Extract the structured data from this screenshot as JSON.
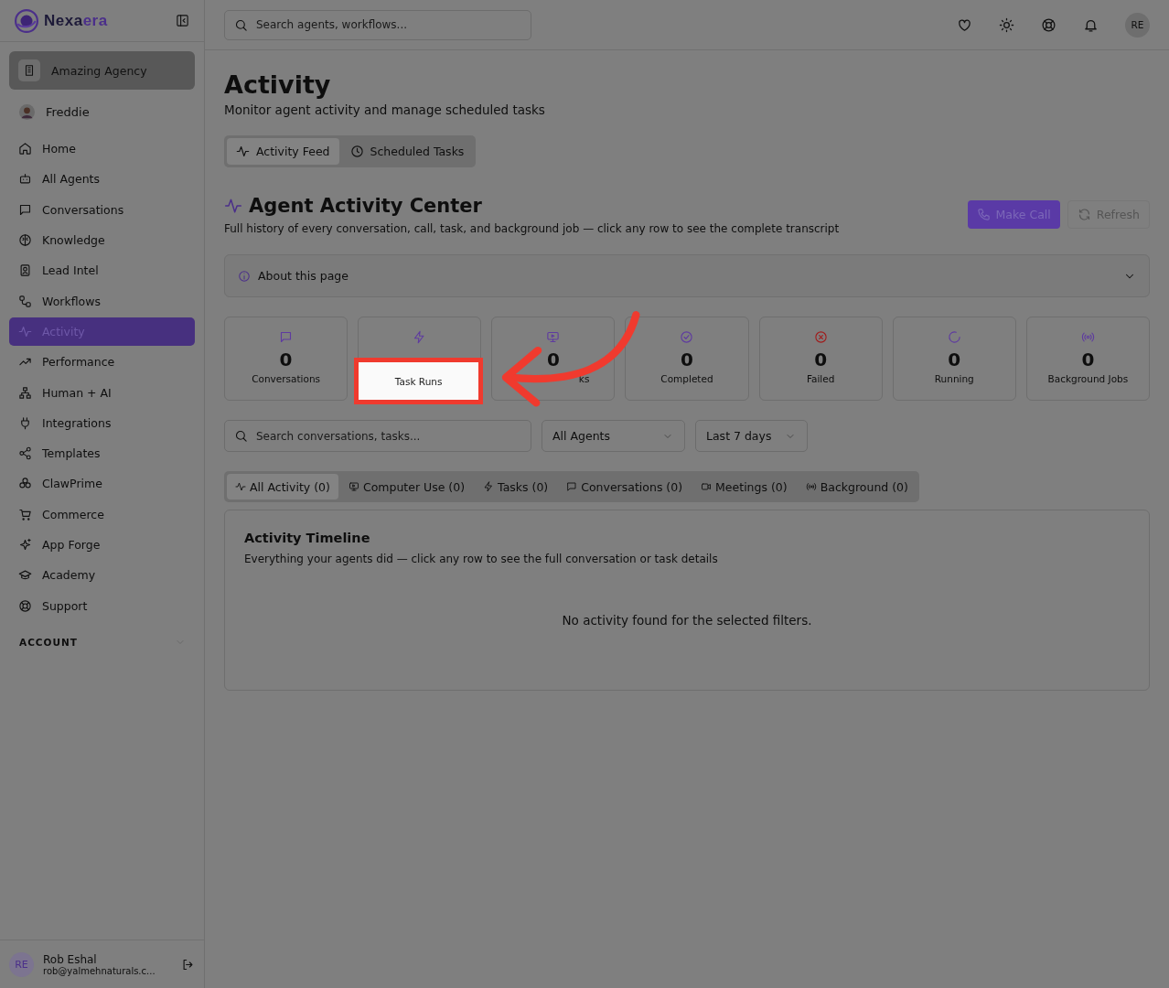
{
  "logo": {
    "main": "Nexa",
    "accent": "era"
  },
  "workspace": "Amazing Agency",
  "agent": "Freddie",
  "nav": [
    {
      "label": "Home",
      "selected": false
    },
    {
      "label": "All Agents",
      "selected": false
    },
    {
      "label": "Conversations",
      "selected": false
    },
    {
      "label": "Knowledge",
      "selected": false
    },
    {
      "label": "Lead Intel",
      "selected": false
    },
    {
      "label": "Workflows",
      "selected": false
    },
    {
      "label": "Activity",
      "selected": true
    },
    {
      "label": "Performance",
      "selected": false
    },
    {
      "label": "Human + AI",
      "selected": false
    },
    {
      "label": "Integrations",
      "selected": false
    },
    {
      "label": "Templates",
      "selected": false
    },
    {
      "label": "ClawPrime",
      "selected": false
    },
    {
      "label": "Commerce",
      "selected": false
    },
    {
      "label": "App Forge",
      "selected": false
    },
    {
      "label": "Academy",
      "selected": false
    },
    {
      "label": "Support",
      "selected": false
    }
  ],
  "account_section": {
    "label": "ACCOUNT",
    "expanded": false
  },
  "user": {
    "initials": "RE",
    "name": "Rob Eshal",
    "email": "rob@yalmehnaturals.c..."
  },
  "topbar": {
    "search_placeholder": "Search agents, workflows...",
    "avatar": "RE"
  },
  "page": {
    "title": "Activity",
    "subtitle": "Monitor agent activity and manage scheduled tasks"
  },
  "view_tabs": [
    {
      "label": "Activity Feed",
      "selected": true
    },
    {
      "label": "Scheduled Tasks",
      "selected": false
    }
  ],
  "section": {
    "title": "Agent Activity Center",
    "description": "Full history of every conversation, call, task, and background job — click any row to see the complete transcript",
    "primary_button": "Make Call",
    "secondary_button": "Refresh"
  },
  "about": {
    "label": "About this page",
    "expanded": false
  },
  "stats": [
    {
      "value": "0",
      "label": "Conversations",
      "color": "#5e3aa0",
      "highlighted": false
    },
    {
      "label": "Task Runs",
      "color": "#5e3aa0",
      "highlighted": true
    },
    {
      "value": "0",
      "label": "ks",
      "color": "#5e3aa0",
      "highlighted": false
    },
    {
      "value": "0",
      "label": "Completed",
      "color": "#5e3aa0",
      "highlighted": false
    },
    {
      "value": "0",
      "label": "Failed",
      "color": "#a11c1c",
      "highlighted": false
    },
    {
      "value": "0",
      "label": "Running",
      "color": "#5e3aa0",
      "highlighted": false
    },
    {
      "value": "0",
      "label": "Background Jobs",
      "color": "#5e3aa0",
      "highlighted": false
    }
  ],
  "filters": {
    "search_placeholder": "Search conversations, tasks...",
    "agent": "All Agents",
    "range": "Last 7 days"
  },
  "filter_tabs": [
    {
      "label": "All Activity (0)",
      "selected": true
    },
    {
      "label": "Computer Use (0)",
      "selected": false
    },
    {
      "label": "Tasks (0)",
      "selected": false
    },
    {
      "label": "Conversations (0)",
      "selected": false
    },
    {
      "label": "Meetings (0)",
      "selected": false
    },
    {
      "label": "Background (0)",
      "selected": false
    }
  ],
  "timeline": {
    "title": "Activity Timeline",
    "description": "Everything your agents did — click any row to see the full conversation or task details",
    "empty": "No activity found for the selected filters."
  }
}
